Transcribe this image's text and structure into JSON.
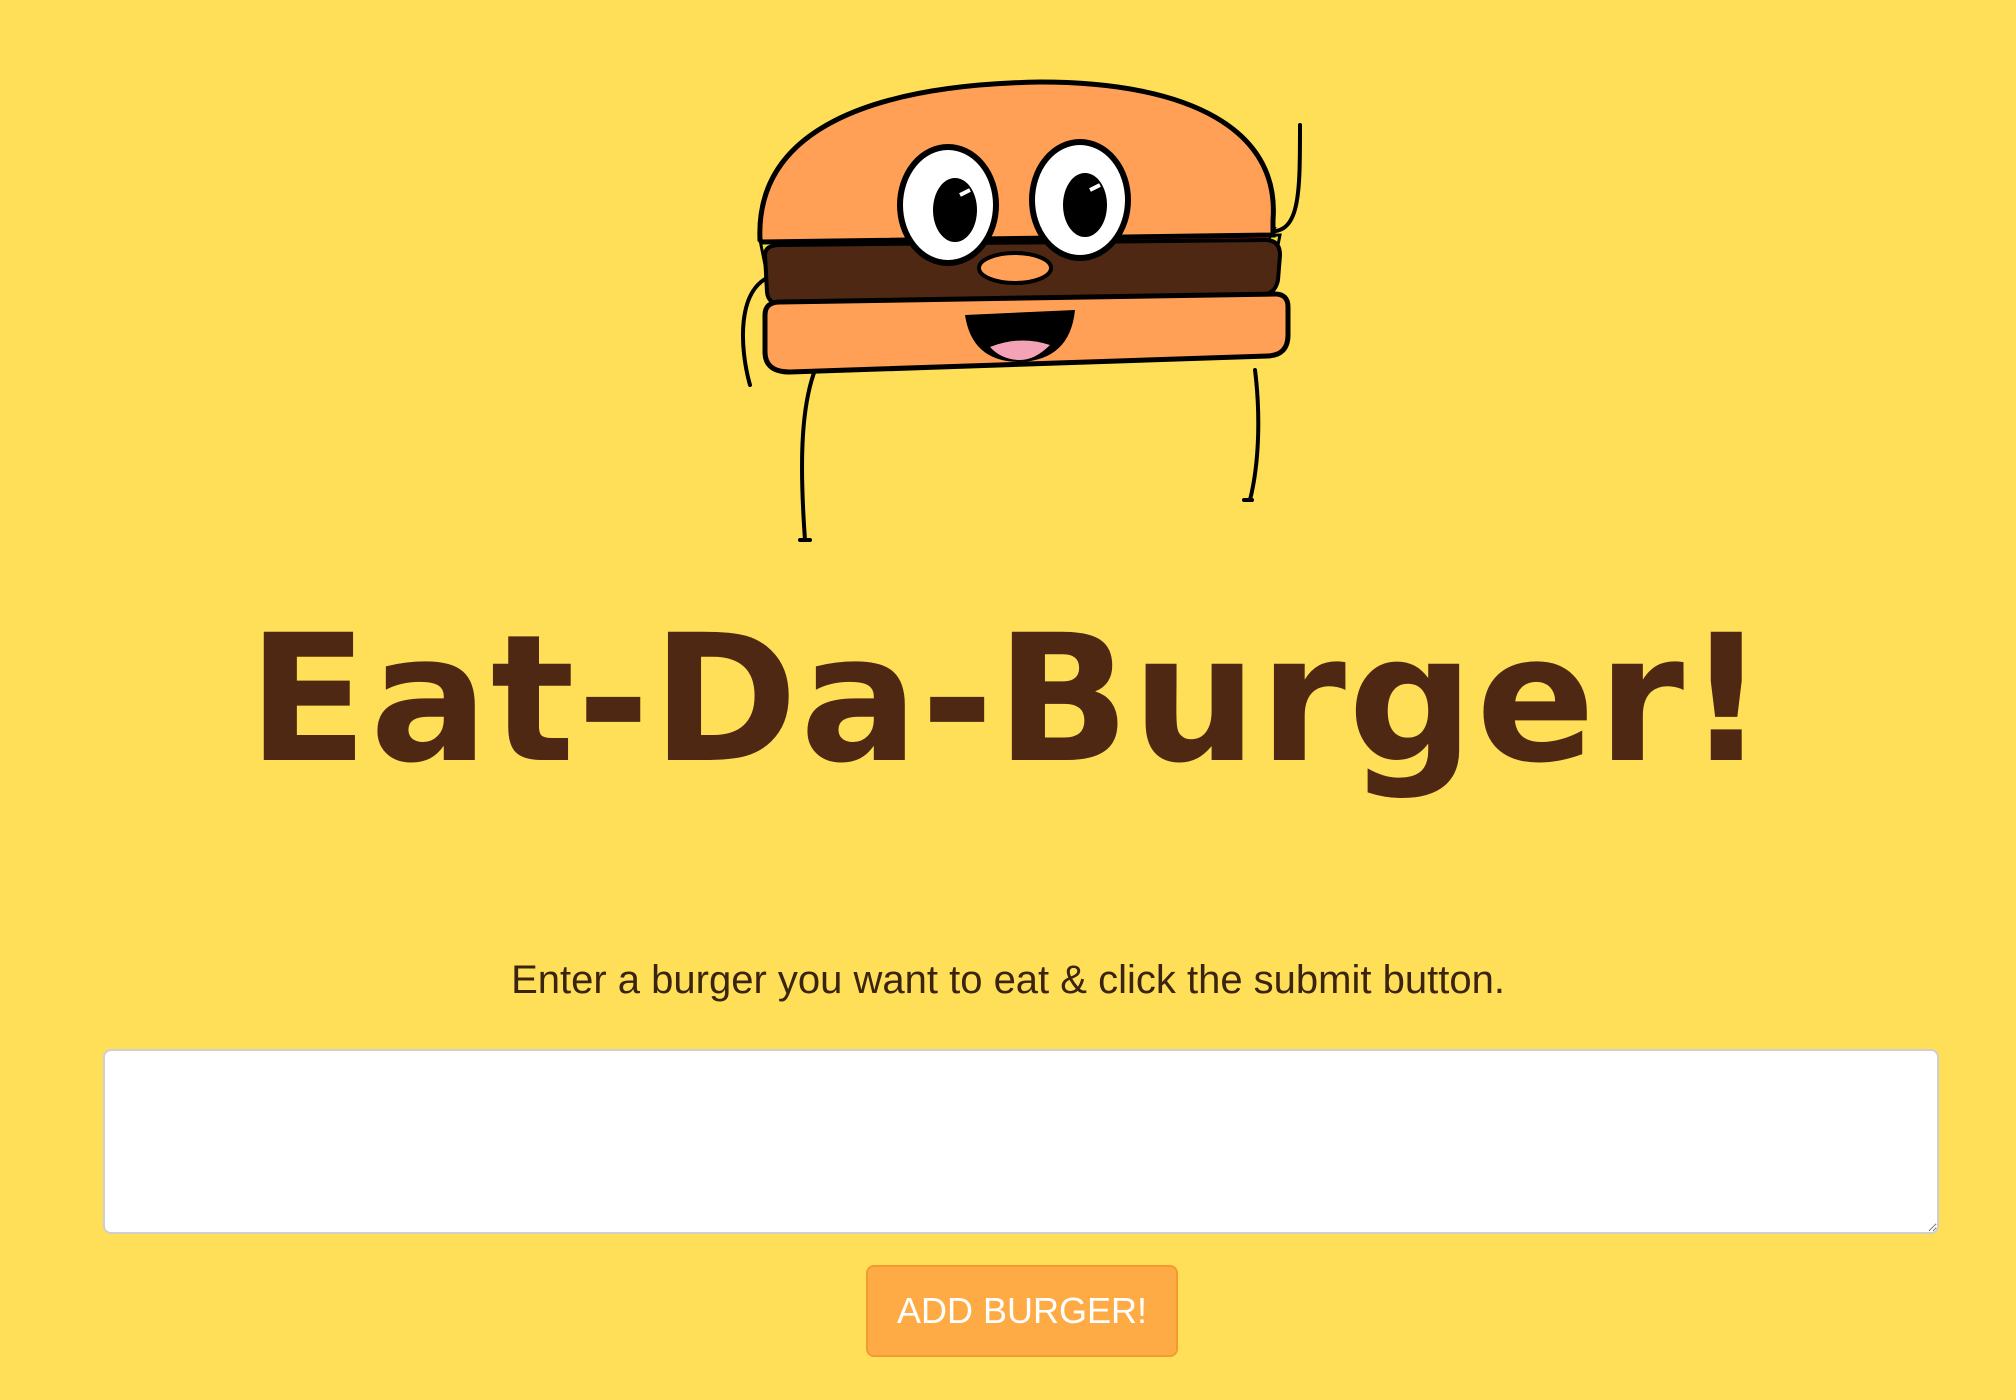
{
  "header": {
    "mascot_icon": "burger-mascot-icon",
    "title": "Eat-Da-Burger!"
  },
  "form": {
    "instructions": "Enter a burger you want to eat & click the submit button.",
    "burger_input_value": "",
    "submit_label": "ADD BURGER!"
  },
  "colors": {
    "background": "#FFDF57",
    "title": "#4E2812",
    "button": "#FFAB45",
    "bun": "#FFA056",
    "patty": "#4E2812"
  }
}
